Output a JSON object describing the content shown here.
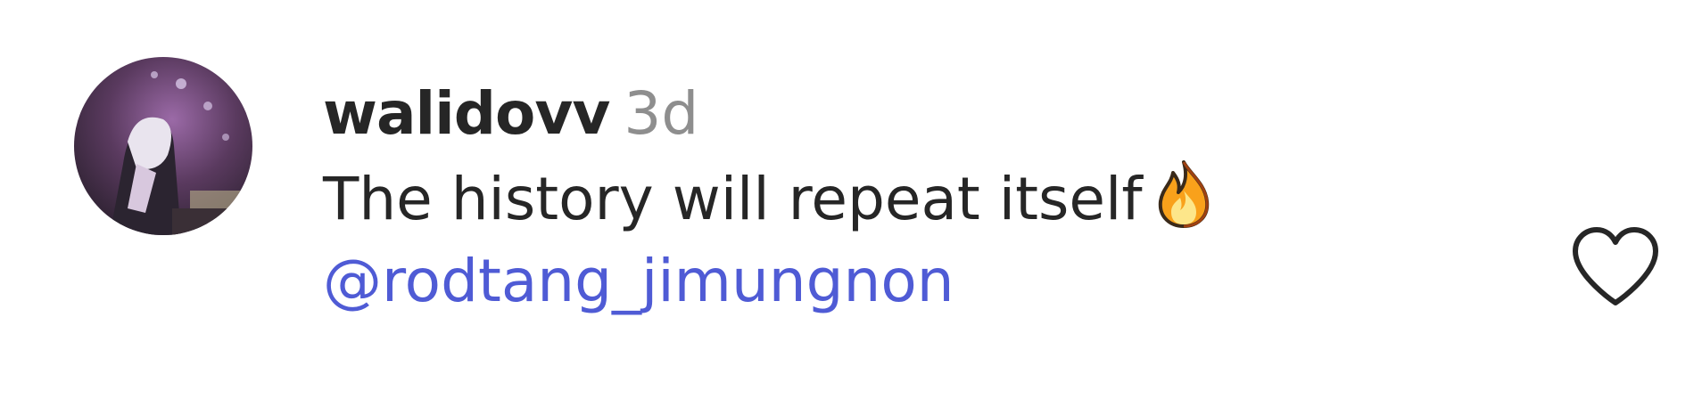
{
  "comment": {
    "username": "walidovv",
    "timestamp": "3d",
    "text": "The history will repeat itself",
    "emoji": "fire-emoji",
    "mention": "@rodtang_jimungnon",
    "like_icon": "heart-outline-icon"
  },
  "colors": {
    "username": "#262626",
    "timestamp": "#8e8e8e",
    "mention": "#4f5bd5",
    "heart_stroke": "#262626"
  }
}
